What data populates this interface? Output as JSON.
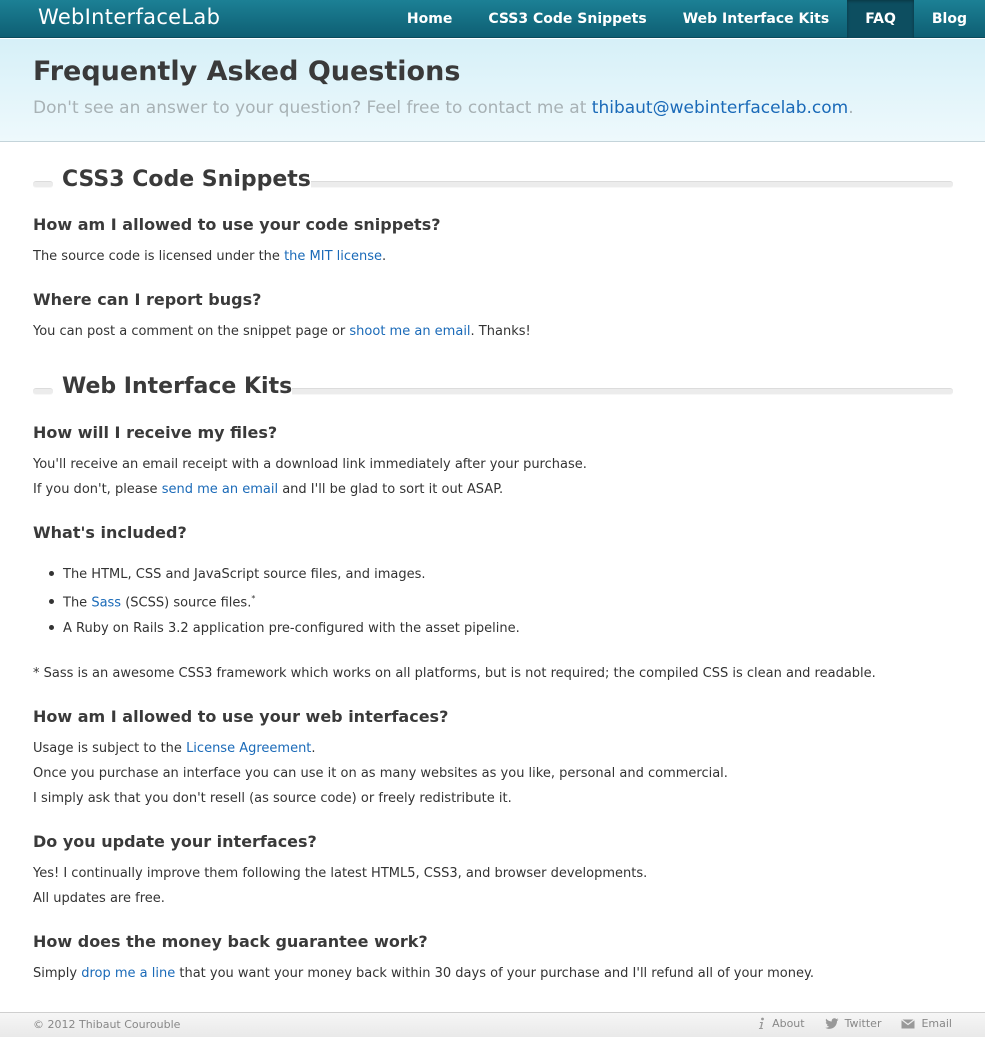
{
  "brand": "WebInterfaceLab",
  "nav": [
    {
      "label": "Home",
      "active": false
    },
    {
      "label": "CSS3 Code Snippets",
      "active": false
    },
    {
      "label": "Web Interface Kits",
      "active": false
    },
    {
      "label": "FAQ",
      "active": true
    },
    {
      "label": "Blog",
      "active": false
    }
  ],
  "hero": {
    "title": "Frequently Asked Questions",
    "subtitle_prefix": "Don't see an answer to your question? Feel free to contact me at ",
    "email": "thibaut@webinterfacelab.com",
    "subtitle_suffix": "."
  },
  "sections": [
    {
      "title": "CSS3 Code Snippets",
      "q1": {
        "question": "How am I allowed to use your code snippets?",
        "text_before": "The source code is licensed under the ",
        "link": "the MIT license",
        "text_after": "."
      },
      "q2": {
        "question": "Where can I report bugs?",
        "text_before": "You can post a comment on the snippet page or ",
        "link": "shoot me an email",
        "text_after": ". Thanks!"
      }
    },
    {
      "title": "Web Interface Kits",
      "q1": {
        "question": "How will I receive my files?",
        "line1": "You'll receive an email receipt with a download link immediately after your purchase.",
        "line2_before": "If you don't, please ",
        "line2_link": "send me an email",
        "line2_after": " and I'll be glad to sort it out ASAP."
      },
      "q2": {
        "question": "What's included?",
        "bullet1": "The HTML, CSS and JavaScript source files, and images.",
        "bullet2_before": "The ",
        "bullet2_link": "Sass",
        "bullet2_after": " (SCSS) source files.",
        "bullet2_sup": "*",
        "bullet3": "A Ruby on Rails 3.2 application pre-configured with the asset pipeline.",
        "footnote": "* Sass is an awesome CSS3 framework which works on all platforms, but is not required; the compiled CSS is clean and readable."
      },
      "q3": {
        "question": "How am I allowed to use your web interfaces?",
        "line1_before": "Usage is subject to the ",
        "line1_link": "License Agreement",
        "line1_after": ".",
        "line2": "Once you purchase an interface you can use it on as many websites as you like, personal and commercial.",
        "line3": "I simply ask that you don't resell (as source code) or freely redistribute it."
      },
      "q4": {
        "question": "Do you update your interfaces?",
        "line1": "Yes! I continually improve them following the latest HTML5, CSS3, and browser developments.",
        "line2": "All updates are free."
      },
      "q5": {
        "question": "How does the money back guarantee work?",
        "line1_before": "Simply ",
        "line1_link": "drop me a line",
        "line1_after": " that you want your money back within 30 days of your purchase and I'll refund all of your money."
      }
    }
  ],
  "footer": {
    "copyright": "© 2012 Thibaut Courouble",
    "links": [
      {
        "label": "About",
        "icon": "info-icon"
      },
      {
        "label": "Twitter",
        "icon": "twitter-bird-icon"
      },
      {
        "label": "Email",
        "icon": "envelope-icon"
      }
    ]
  }
}
